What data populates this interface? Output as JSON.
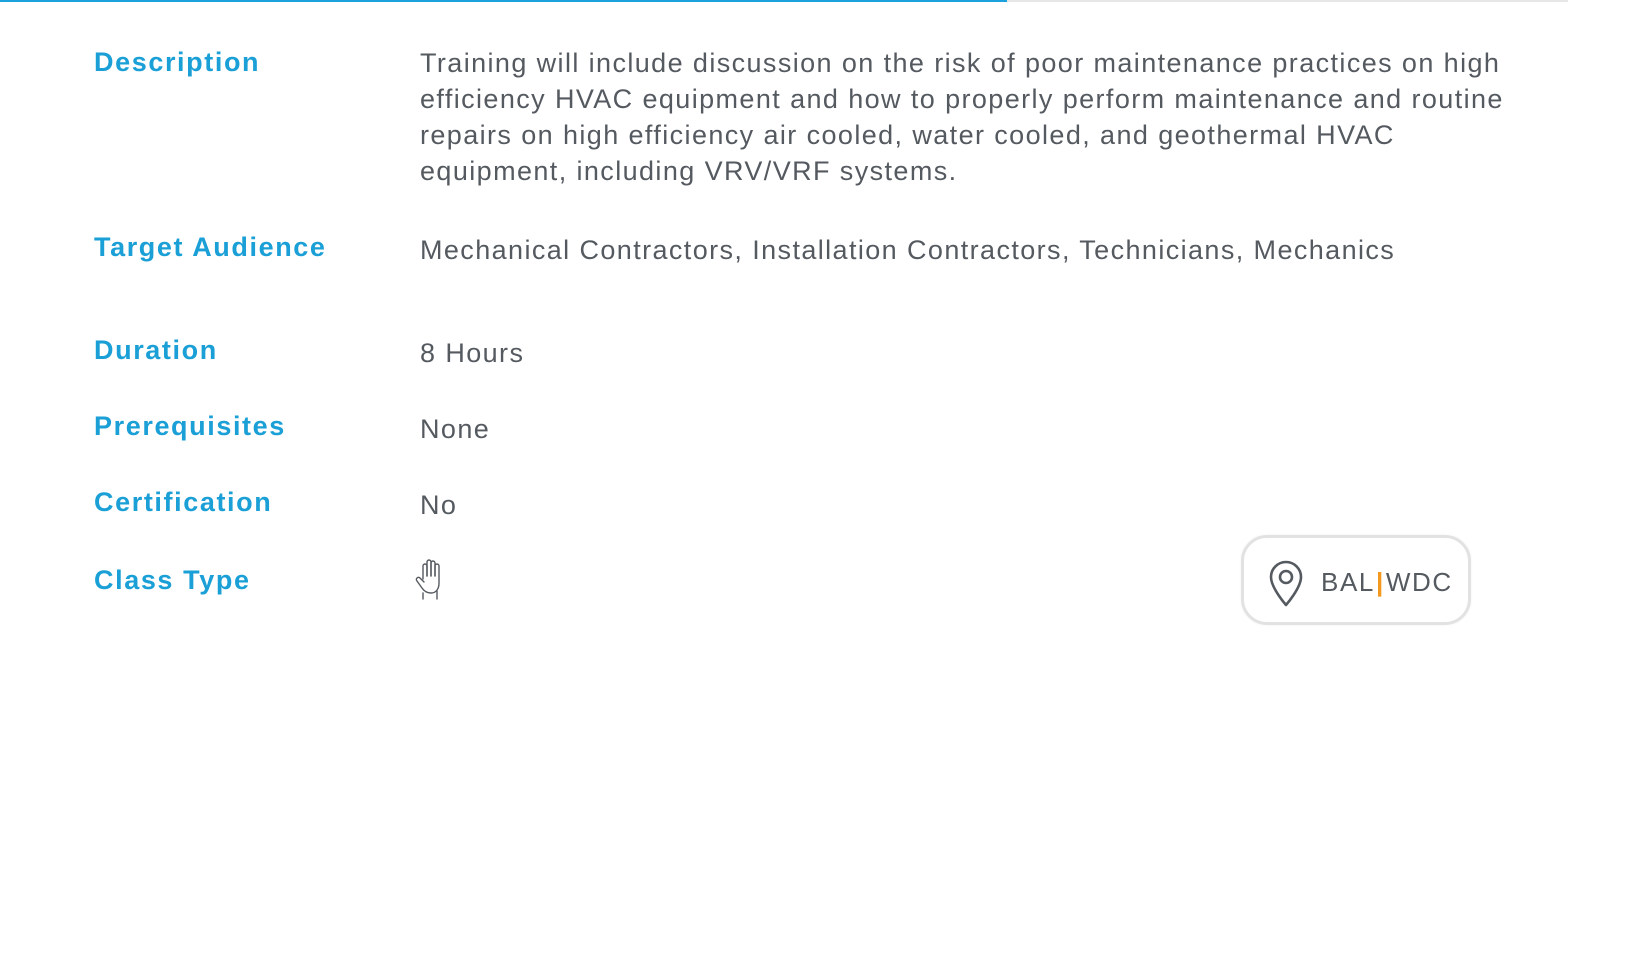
{
  "progress": {
    "fraction": 0.642,
    "fill_color": "#1ba1dc",
    "track_color": "#e6e6e6"
  },
  "colors": {
    "label": "#1a9fd6",
    "value_text": "#555a60",
    "separator": "#f39a1e"
  },
  "details": {
    "description": {
      "label": "Description",
      "value": "Training will include discussion on the risk of poor maintenance practices on high efficiency HVAC equipment and how to properly perform maintenance and routine repairs on high efficiency air cooled, water cooled, and geothermal HVAC equipment, including VRV/VRF systems."
    },
    "target_audience": {
      "label": "Target Audience",
      "value": "Mechanical Contractors, Installation Contractors, Technicians, Mechanics"
    },
    "duration": {
      "label": "Duration",
      "value": "8 Hours"
    },
    "prerequisites": {
      "label": "Prerequisites",
      "value": "None"
    },
    "certification": {
      "label": "Certification",
      "value": "No"
    },
    "class_type": {
      "label": "Class Type",
      "icon": "hand-icon"
    }
  },
  "location": {
    "icon": "map-pin-icon",
    "primary": "BAL",
    "separator": "|",
    "secondary": "WDC"
  }
}
